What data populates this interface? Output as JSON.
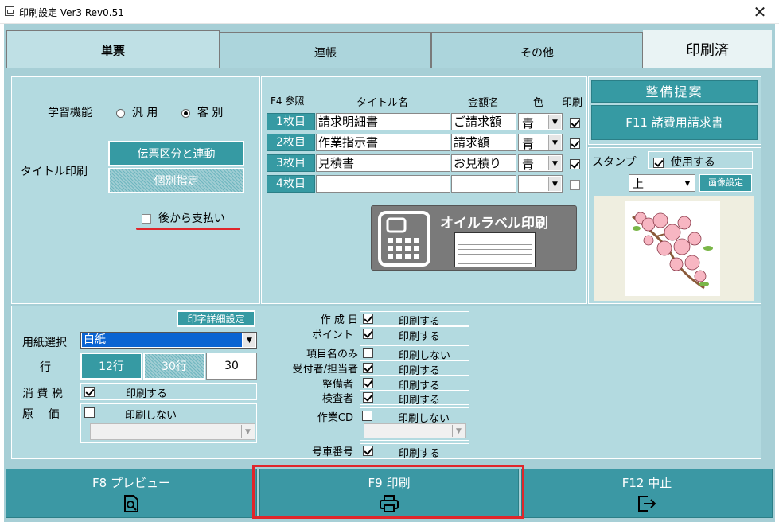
{
  "window": {
    "title": "印刷設定 Ver3 Rev0.51",
    "close": "✕"
  },
  "tabs": [
    {
      "label": "単票"
    },
    {
      "label": "連帳"
    },
    {
      "label": "その他"
    },
    {
      "label": "印刷済"
    }
  ],
  "left": {
    "learning_label": "学習機能",
    "radio_general": "汎 用",
    "radio_customer": "客 別",
    "title_print_label": "タイトル印刷",
    "link_button": "伝票区分と連動",
    "individual_button": "個別指定",
    "deferred_pay": "後から支払い"
  },
  "table": {
    "headers": {
      "f4": "F4 参照",
      "title": "タイトル名",
      "amount": "金額名",
      "color": "色",
      "print": "印刷"
    },
    "rows": [
      {
        "no": "1枚目",
        "title": "請求明細書",
        "amount": "ご請求額",
        "color": "青",
        "print": true
      },
      {
        "no": "2枚目",
        "title": "作業指示書",
        "amount": "請求額",
        "color": "青",
        "print": true
      },
      {
        "no": "3枚目",
        "title": "見積書",
        "amount": "お見積り",
        "color": "青",
        "print": true
      },
      {
        "no": "4枚目",
        "title": "",
        "amount": "",
        "color": "",
        "print": false
      }
    ]
  },
  "oil_label": {
    "text": "オイルラベル印刷"
  },
  "right": {
    "proposal": "整備提案",
    "f11": "F11 諸費用請求書",
    "stamp_label": "スタンプ",
    "stamp_use": "使用する",
    "stamp_pos": "上",
    "image_settings": "画像設定"
  },
  "bottom_left": {
    "detail_btn": "印字詳細設定",
    "paper_label": "用紙選択",
    "paper_value": "白紙",
    "rows_label": "行",
    "row12": "12行",
    "row30": "30行",
    "row_value": "30",
    "tax_label": "消 費 税",
    "tax_value": "印刷する",
    "cost_label": "原　 価",
    "cost_value": "印刷しない"
  },
  "options": [
    {
      "label": "作 成 日",
      "checked": true,
      "value": "印刷する"
    },
    {
      "label": "ポイント",
      "checked": true,
      "value": "印刷する"
    },
    {
      "label": "項目名のみ",
      "checked": false,
      "value": "印刷しない"
    },
    {
      "label": "受付者/担当者",
      "checked": true,
      "value": "印刷する"
    },
    {
      "label": "整備者",
      "checked": true,
      "value": "印刷する"
    },
    {
      "label": "検査者",
      "checked": true,
      "value": "印刷する"
    },
    {
      "label": "作業CD",
      "checked": false,
      "value": "印刷しない"
    },
    {
      "label": "号車番号",
      "checked": true,
      "value": "印刷する"
    }
  ],
  "footer": {
    "f8": "F8 プレビュー",
    "f9": "F9 印刷",
    "f12": "F12 中止"
  },
  "colors": {
    "teal": "#369aa3",
    "panel": "#b3dae0",
    "highlight": "#e0262b"
  }
}
